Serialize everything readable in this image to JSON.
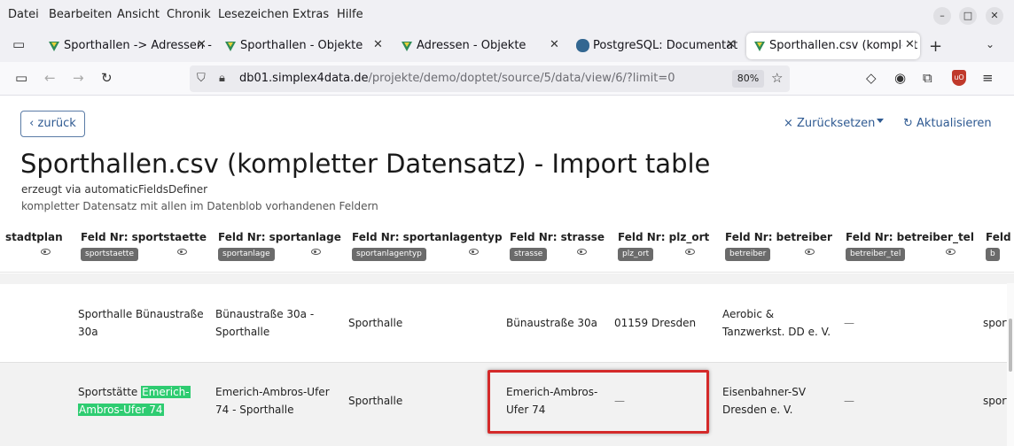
{
  "menubar": {
    "items": [
      "Datei",
      "Bearbeiten",
      "Ansicht",
      "Chronik",
      "Lesezeichen",
      "Extras",
      "Hilfe"
    ],
    "minimize": "–",
    "maximize": "□",
    "close": "✕"
  },
  "tabs": [
    {
      "label": "Sporthallen -> Adressen -",
      "close": "✕"
    },
    {
      "label": "Sporthallen - Objekte",
      "close": "✕"
    },
    {
      "label": "Adressen - Objekte",
      "close": "✕"
    },
    {
      "label": "PostgreSQL: Documentat",
      "close": "✕"
    },
    {
      "label": "Sporthallen.csv (komplett",
      "close": "✕"
    }
  ],
  "tabstrip": {
    "newtab": "+",
    "list": "⌄"
  },
  "nav": {
    "back": "←",
    "forward": "→",
    "reload": "↻",
    "sidebar": "▭",
    "url_host": "db01.simplex4data.de",
    "url_path": "/projekte/demo/doptet/source/5/data/view/6/?limit=0",
    "zoom": "80%",
    "bookmark": "☆",
    "pocket": "◇",
    "account": "◉",
    "extensions": "⧉",
    "menu": "≡",
    "ublock": "uO"
  },
  "page": {
    "back_label": "‹ zurück",
    "reset_label": "× Zurücksetzen",
    "refresh_label": "↻ Aktualisieren",
    "title": "Sporthallen.csv (kompletter Datensatz) - Import table",
    "generated": "erzeugt via automaticFieldsDefiner",
    "description": "kompletter Datensatz mit allen im Datenblob vorhandenen Feldern"
  },
  "table": {
    "headers": [
      {
        "label": "stadtplan",
        "badge": ""
      },
      {
        "label": "Feld Nr: sportstaette",
        "badge": "sportstaette"
      },
      {
        "label": "Feld Nr: sportanlage",
        "badge": "sportanlage"
      },
      {
        "label": "Feld Nr: sportanlagentyp",
        "badge": "sportanlagentyp"
      },
      {
        "label": "Feld Nr: strasse",
        "badge": "strasse"
      },
      {
        "label": "Feld Nr: plz_ort",
        "badge": "plz_ort"
      },
      {
        "label": "Feld Nr: betreiber",
        "badge": "betreiber"
      },
      {
        "label": "Feld Nr: betreiber_tel",
        "badge": "betreiber_tel"
      },
      {
        "label": "Feld",
        "badge": "b"
      }
    ],
    "rows": [
      {
        "sportstaette_1": "Sporthalle Bünaustraße",
        "sportstaette_2": "30a",
        "sportanlage_1": "Bünaustraße 30a -",
        "sportanlage_2": "Sporthalle",
        "sportanlagentyp": "Sporthalle",
        "strasse": "Bünaustraße 30a",
        "plz_ort": "01159 Dresden",
        "betreiber_1": "Aerobic &",
        "betreiber_2": "Tanzwerkst. DD e. V.",
        "betreiber_tel": "—",
        "next": "sport"
      },
      {
        "sportstaette_pre": "Sportstätte ",
        "sportstaette_hl1": "Emerich-",
        "sportstaette_hl2": "Ambros-Ufer 74",
        "sportanlage_1": "Emerich-Ambros-Ufer",
        "sportanlage_2": "74 - Sporthalle",
        "sportanlagentyp": "Sporthalle",
        "strasse_1": "Emerich-Ambros-",
        "strasse_2": "Ufer 74",
        "plz_ort": "—",
        "betreiber_1": "Eisenbahner-SV",
        "betreiber_2": "Dresden e. V.",
        "betreiber_tel": "—",
        "next": "sport"
      }
    ]
  },
  "colors": {
    "highlight": "#2ecc71",
    "annotation_box": "#d42a2a",
    "link": "#2f5a92",
    "badge": "#6b6b6b"
  }
}
